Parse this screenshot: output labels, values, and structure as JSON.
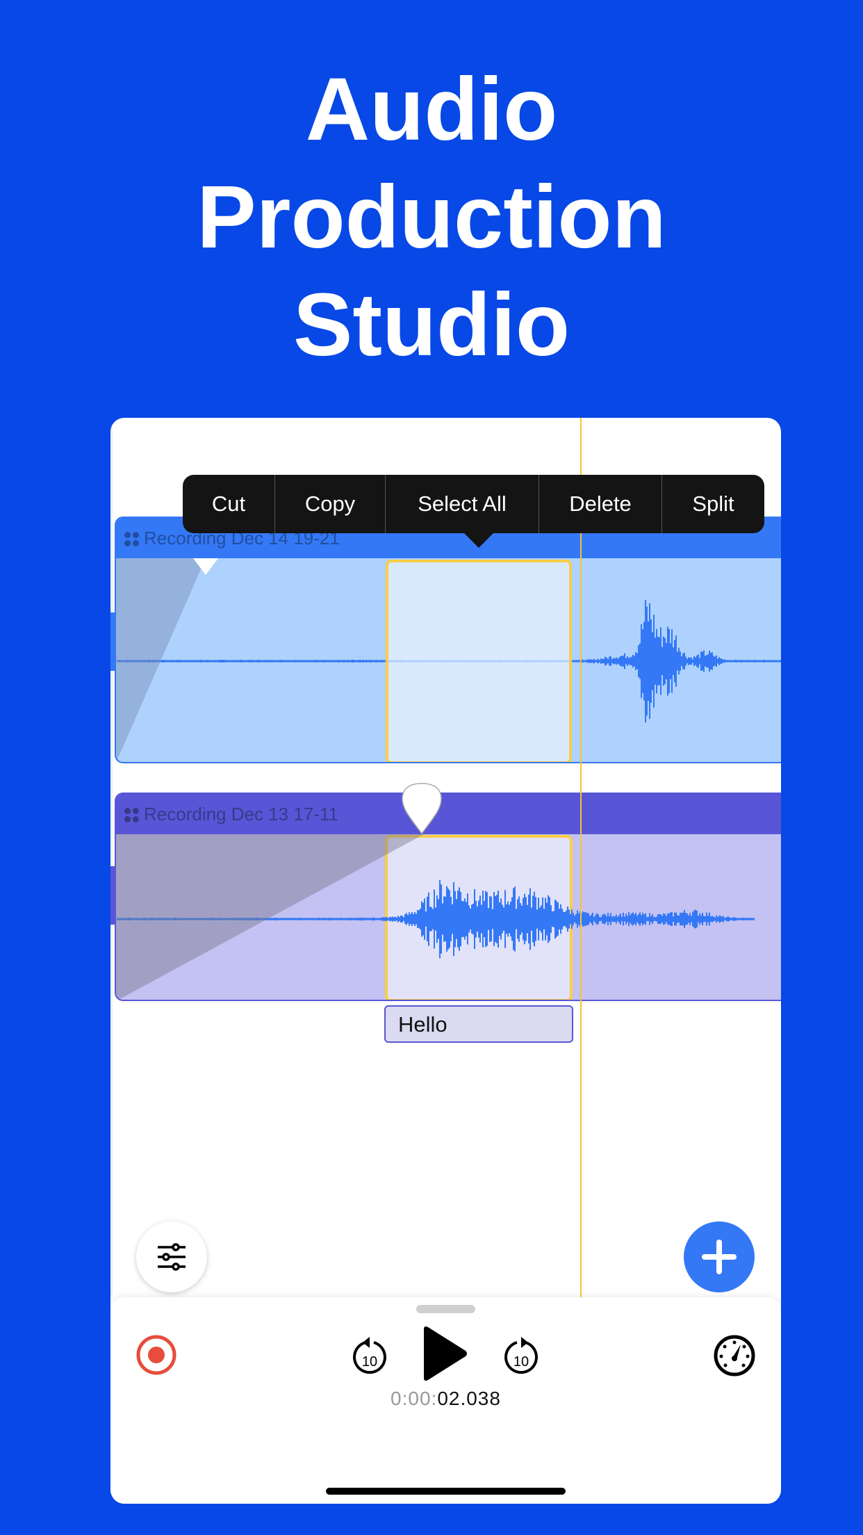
{
  "headline": [
    "Audio",
    "Production",
    "Studio"
  ],
  "context_menu": [
    "Cut",
    "Copy",
    "Select All",
    "Delete",
    "Split"
  ],
  "tracks": [
    {
      "name": "Recording Dec 14 19-21",
      "color": "#3478F6",
      "body_color": "#AED2FD"
    },
    {
      "name": "Recording Dec 13 17-11",
      "color": "#5856D6",
      "body_color": "#C3C2F2",
      "label": "Hello"
    }
  ],
  "transport": {
    "time_dim": "0:00:",
    "time_main": "02.038",
    "rewind_seconds": "10",
    "forward_seconds": "10"
  },
  "colors": {
    "background": "#0748E6",
    "selection": "#F9CD48",
    "record": "#E74C3C",
    "accent": "#3478F6"
  },
  "icons": [
    "sliders-icon",
    "plus-icon",
    "record-icon",
    "rewind-10-icon",
    "play-icon",
    "forward-10-icon",
    "speedometer-icon"
  ]
}
